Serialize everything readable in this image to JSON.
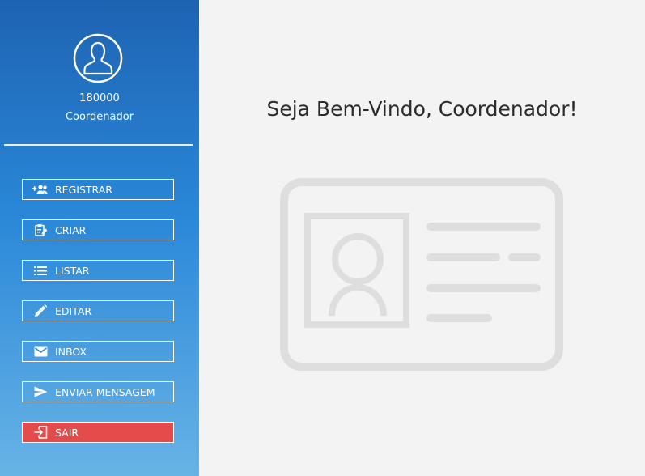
{
  "user": {
    "id": "180000",
    "role": "Coordenador"
  },
  "menu": {
    "items": [
      {
        "label": "REGISTRAR",
        "icon": "add-group-icon"
      },
      {
        "label": "CRIAR",
        "icon": "clipboard-edit-icon"
      },
      {
        "label": "LISTAR",
        "icon": "list-icon"
      },
      {
        "label": "EDITAR",
        "icon": "pencil-icon"
      },
      {
        "label": "INBOX",
        "icon": "mail-icon"
      },
      {
        "label": "ENVIAR MENSAGEM",
        "icon": "send-icon"
      },
      {
        "label": "SAIR",
        "icon": "logout-icon"
      }
    ]
  },
  "main": {
    "welcome": "Seja Bem-Vindo, Coordenador!"
  },
  "colors": {
    "sidebar_top": "#1e63b2",
    "sidebar_bottom": "#67b3e6",
    "logout": "#e44c4c",
    "illustration": "#dedede"
  }
}
